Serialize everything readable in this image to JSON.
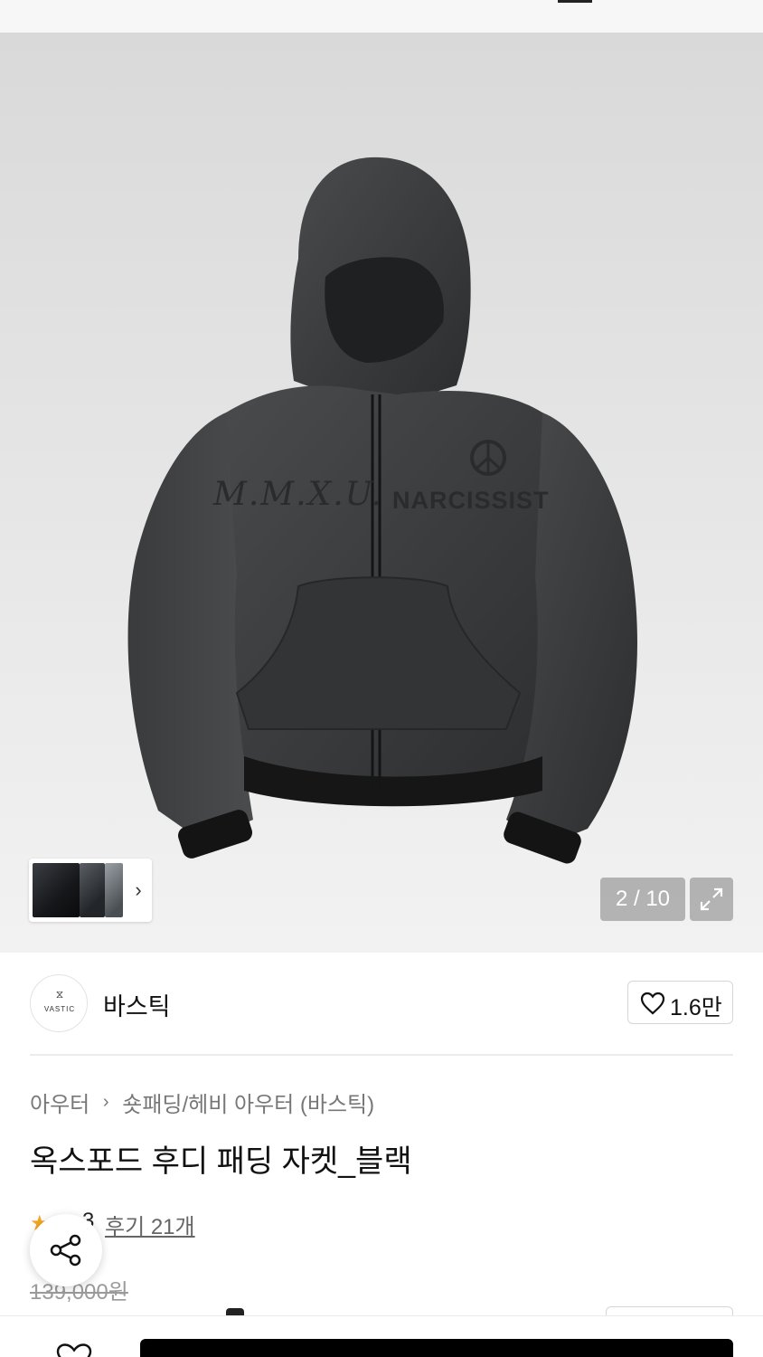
{
  "gallery": {
    "current_index": 2,
    "total": 10,
    "counter_text": "2 / 10",
    "image_description_icon": "product-photo-hooded-padding-jacket",
    "jacket_prints": {
      "chest_left": "M.M.X.U.",
      "chest_right": "NARCISSIST"
    },
    "thumb_chevron": "›",
    "expand_icon": "expand-icon"
  },
  "brand": {
    "logo_glyph": "⧖",
    "logo_text": "VASTIC",
    "name": "바스틱",
    "like_count": "1.6만"
  },
  "breadcrumb": {
    "category": "아우터",
    "separator": "›",
    "subcategory": "숏패딩/헤비 아우터 (바스틱)"
  },
  "product": {
    "title": "옥스포드 후디 패딩 자켓_블랙",
    "rating": "3",
    "review_text": "후기 21개",
    "original_price": "139,000원"
  },
  "colors": {
    "star": "#f5a623",
    "buy_button": "#000000",
    "counter_bg": "rgba(140,140,140,0.62)"
  }
}
